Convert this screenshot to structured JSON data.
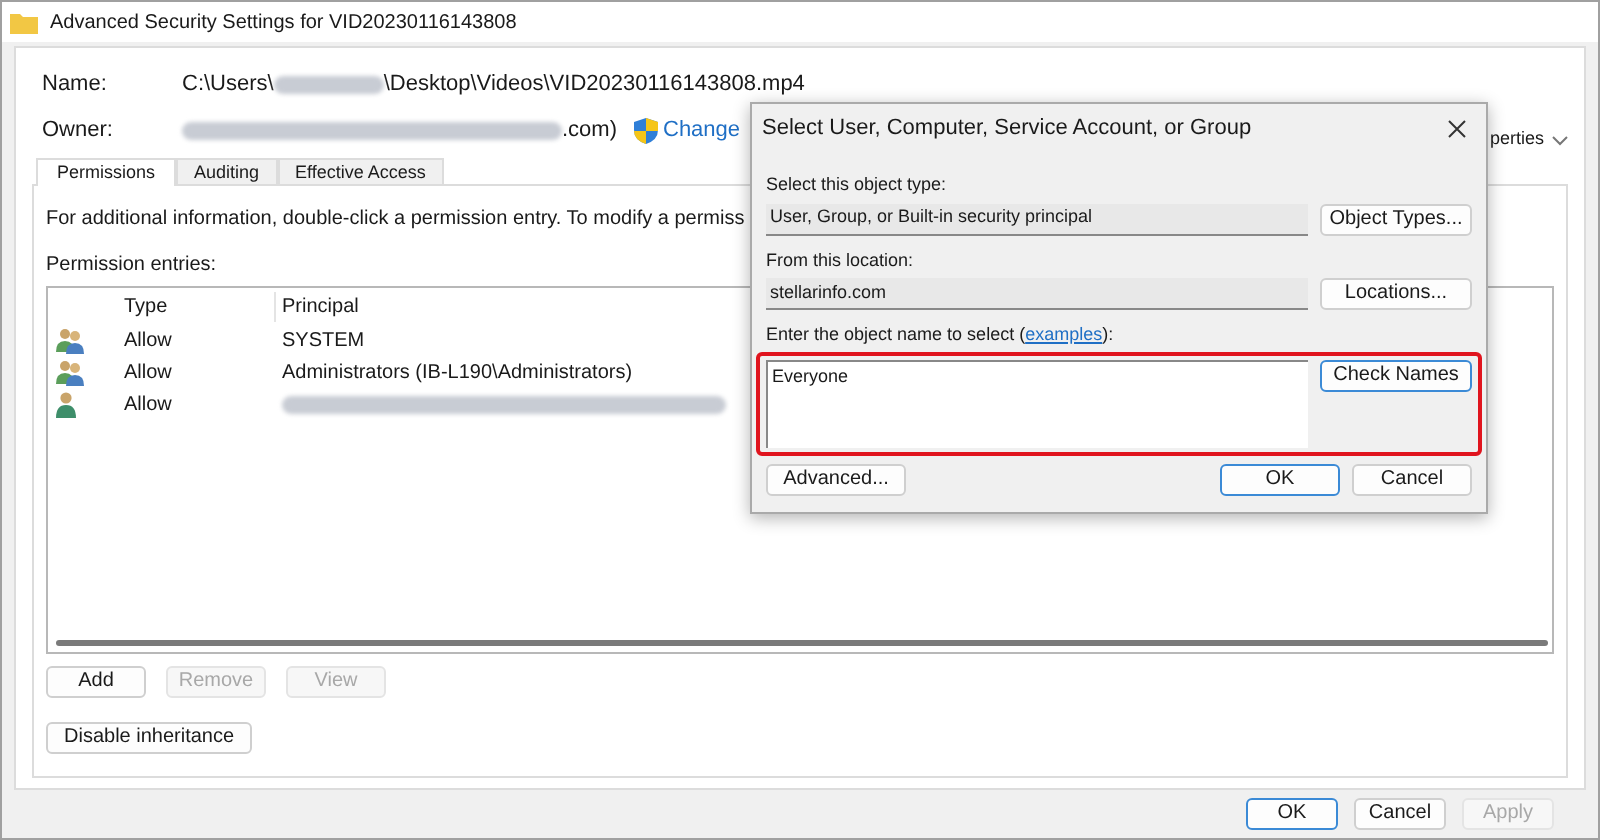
{
  "window": {
    "title": "Advanced Security Settings for VID20230116143808"
  },
  "name": {
    "label": "Name:",
    "path_start": "C:\\Users\\",
    "path_end": "\\Desktop\\Videos\\VID20230116143808.mp4"
  },
  "owner": {
    "label": "Owner:",
    "value_end": ".com)",
    "change_link": "Change"
  },
  "behind_text": "perties",
  "tabs": [
    {
      "label": "Permissions",
      "selected": true
    },
    {
      "label": "Auditing",
      "selected": false
    },
    {
      "label": "Effective Access",
      "selected": false
    }
  ],
  "info_text": "For additional information, double-click a permission entry. To modify a permiss",
  "entries_label": "Permission entries:",
  "table": {
    "columns": [
      "Type",
      "Principal"
    ],
    "rows": [
      {
        "kind": "group",
        "type": "Allow",
        "principal": "SYSTEM",
        "redacted": false
      },
      {
        "kind": "group",
        "type": "Allow",
        "principal": "Administrators (IB-L190\\Administrators)",
        "redacted": false
      },
      {
        "kind": "user",
        "type": "Allow",
        "redacted": true
      }
    ]
  },
  "buttons": [
    {
      "label": "Add",
      "disabled": false
    },
    {
      "label": "Remove",
      "disabled": true
    },
    {
      "label": "View",
      "disabled": true
    }
  ],
  "disable_inheritance": "Disable inheritance",
  "footer_buttons": [
    {
      "label": "OK",
      "default": true,
      "disabled": false
    },
    {
      "label": "Cancel",
      "default": false,
      "disabled": false
    },
    {
      "label": "Apply",
      "default": false,
      "disabled": true
    }
  ],
  "dialog": {
    "title": "Select User, Computer, Service Account, or Group",
    "object_type_label": "Select this object type:",
    "object_type_value": "User, Group, or Built-in security principal",
    "object_types_button": "Object Types...",
    "location_label": "From this location:",
    "location_value": "stellarinfo.com",
    "locations_button": "Locations...",
    "enter_label_start": "Enter the object name to select (",
    "examples_link": "examples",
    "enter_label_end": "):",
    "object_name": "Everyone",
    "check_names_button": "Check Names",
    "highlighted": true,
    "advanced_button": "Advanced...",
    "ok_button": "OK",
    "cancel_button": "Cancel"
  }
}
